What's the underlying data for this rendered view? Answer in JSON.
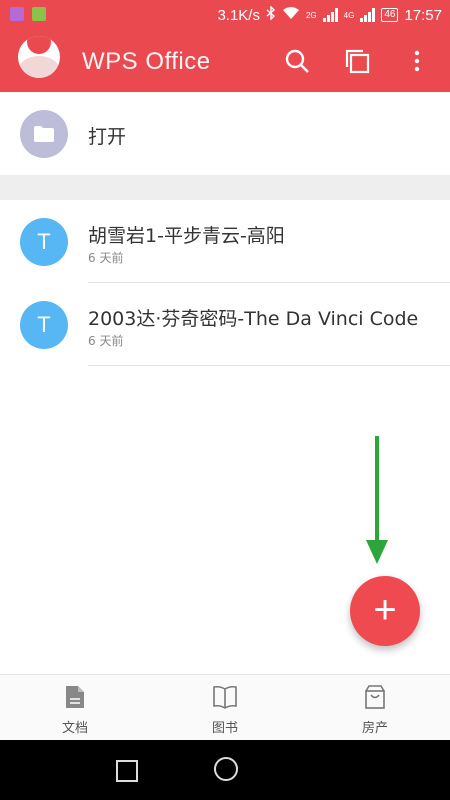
{
  "status_bar": {
    "speed": "3.1K/s",
    "network_2g": "2G",
    "network_4g": "4G",
    "battery": "46",
    "time": "17:57"
  },
  "app_bar": {
    "title": "WPS Office",
    "icons": [
      "search-icon",
      "multi-window-icon",
      "more-vert-icon"
    ]
  },
  "open_row": {
    "label": "打开",
    "icon": "folder-icon"
  },
  "recent_files": [
    {
      "badge": "T",
      "name": "胡雪岩1-平步青云-高阳",
      "time": "6 天前"
    },
    {
      "badge": "T",
      "name": "2003达·芬奇密码-The Da Vinci Code",
      "time": "6 天前"
    }
  ],
  "fab": {
    "symbol": "+"
  },
  "bottom_nav": [
    {
      "label": "文档",
      "icon": "document-icon"
    },
    {
      "label": "图书",
      "icon": "book-icon"
    },
    {
      "label": "房产",
      "icon": "bag-icon"
    }
  ],
  "colors": {
    "primary": "#ea4a4f",
    "fab": "#ef4a50",
    "badge": "#57b7f5",
    "folder": "#bdbdd9",
    "annotation_arrow": "#2ca53a"
  }
}
